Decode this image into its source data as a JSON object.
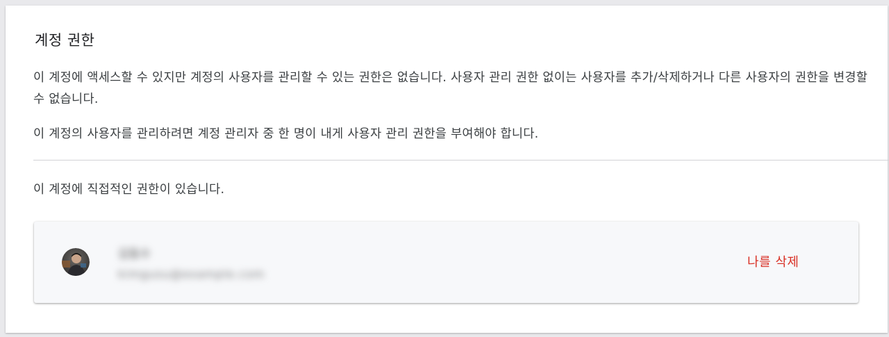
{
  "section": {
    "title": "계정 권한",
    "description_1": "이 계정에 액세스할 수 있지만 계정의 사용자를 관리할 수 있는 권한은 없습니다. 사용자 관리 권한 없이는 사용자를 추가/삭제하거나 다른 사용자의 권한을 변경할 수 없습니다.",
    "description_2": "이 계정의 사용자를 관리하려면 계정 관리자 중 한 명이 내게 사용자 관리 권한을 부여해야 합니다.",
    "direct_permission_text": "이 계정에 직접적인 권한이 있습니다."
  },
  "user": {
    "name": "김동수",
    "email": "kimgusu@example.com",
    "remove_label": "나를 삭제"
  },
  "colors": {
    "remove_accent": "#d93025"
  }
}
